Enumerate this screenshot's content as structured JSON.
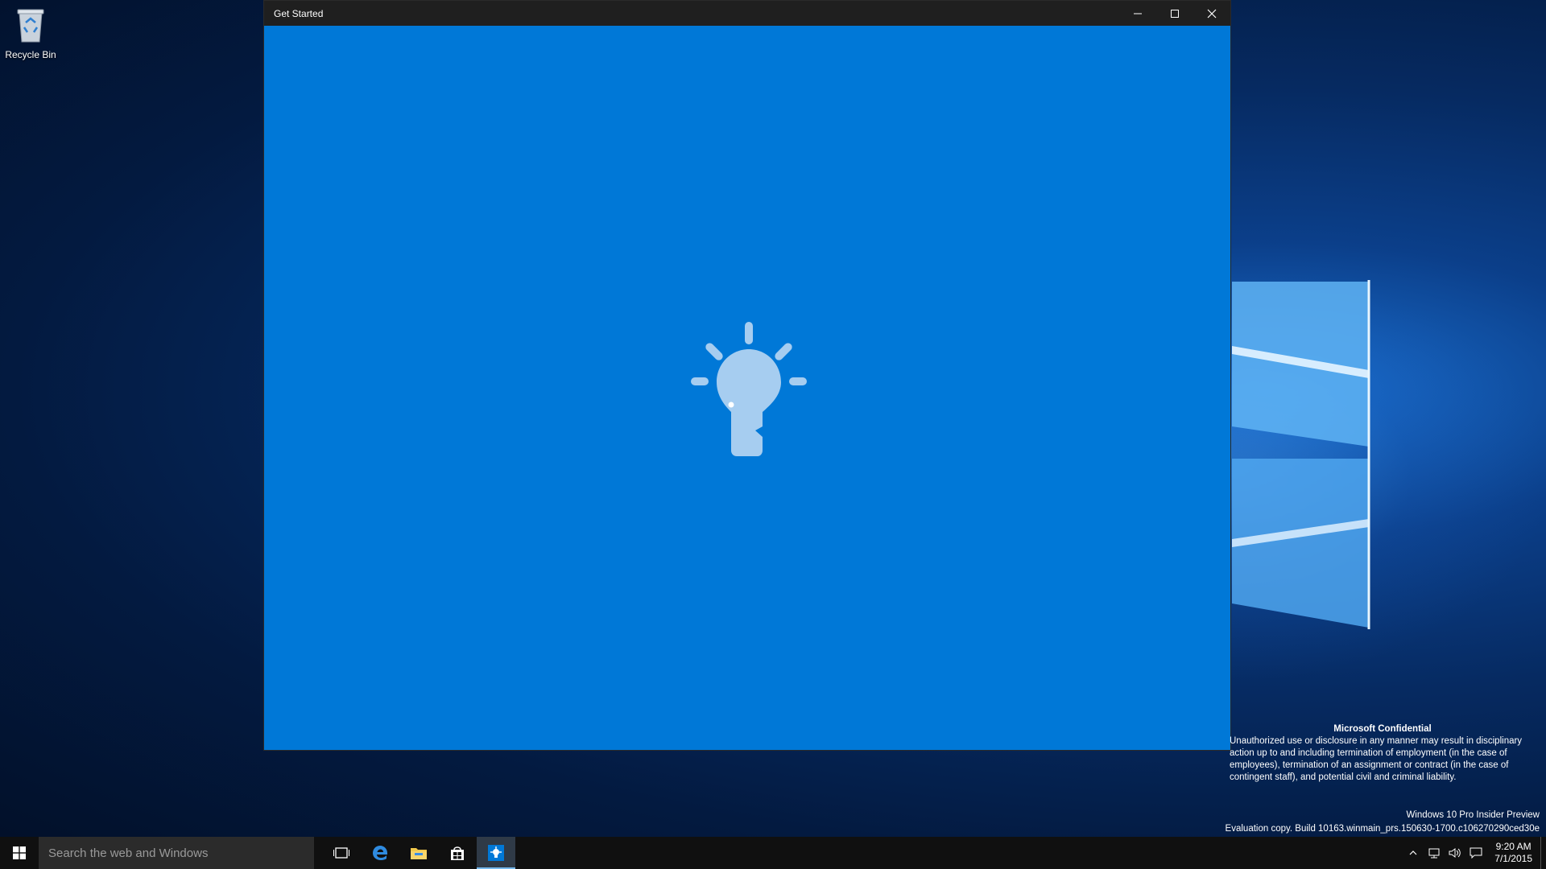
{
  "desktop": {
    "recycle_bin_label": "Recycle Bin"
  },
  "window": {
    "title": "Get Started",
    "background": "#0078d7",
    "titlebar_color": "#1f1f1f"
  },
  "notice": {
    "heading": "Microsoft Confidential",
    "body": "Unauthorized use or disclosure in any manner may result in disciplinary action up to and including termination of employment (in the case of employees), termination of an assignment or contract (in the case of contingent staff), and potential civil and criminal liability."
  },
  "watermark": {
    "edition": "Windows 10 Pro Insider Preview",
    "build": "Evaluation copy. Build 10163.winmain_prs.150630-1700.c106270290ced30e"
  },
  "taskbar": {
    "search_placeholder": "Search the web and Windows",
    "pinned": [
      "task-view-icon",
      "edge-icon",
      "file-explorer-icon",
      "store-icon",
      "get-started-icon"
    ],
    "time": "9:20 AM",
    "date": "7/1/2015"
  }
}
